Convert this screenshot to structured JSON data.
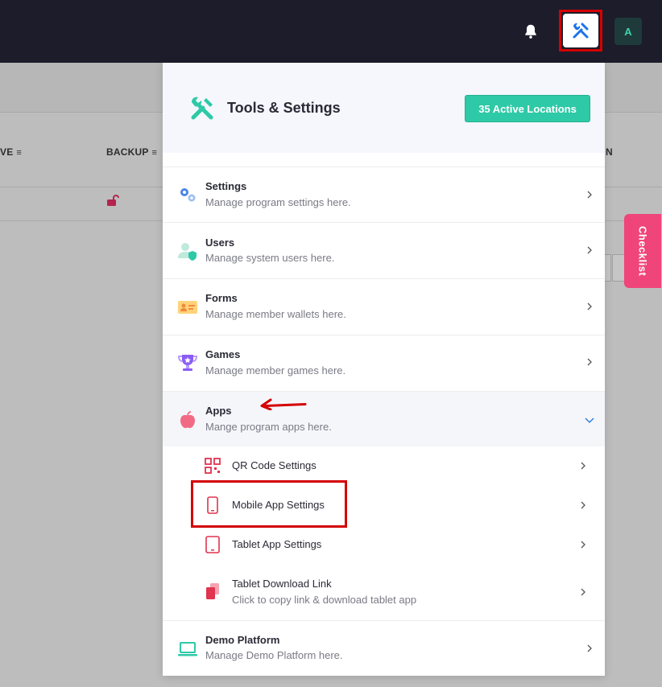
{
  "topbar": {
    "avatar_letter": "A",
    "icons": [
      "bell-icon",
      "tools-icon"
    ]
  },
  "background": {
    "columns": [
      "VE",
      "BACKUP",
      "N"
    ],
    "checklist_label": "Checklist"
  },
  "panel": {
    "title": "Tools & Settings",
    "badge": "35 Active Locations",
    "items": [
      {
        "title": "Settings",
        "desc": "Manage program settings here.",
        "icon": "gears-icon"
      },
      {
        "title": "Users",
        "desc": "Manage system users here.",
        "icon": "user-shield-icon"
      },
      {
        "title": "Forms",
        "desc": "Manage member wallets here.",
        "icon": "id-card-icon"
      },
      {
        "title": "Games",
        "desc": "Manage member games here.",
        "icon": "trophy-icon"
      },
      {
        "title": "Apps",
        "desc": "Mange program apps here.",
        "icon": "apple-icon"
      }
    ],
    "sub_items": [
      {
        "title": "QR Code Settings",
        "icon": "qr-code-icon"
      },
      {
        "title": "Mobile App Settings",
        "icon": "mobile-icon"
      },
      {
        "title": "Tablet App Settings",
        "icon": "tablet-icon"
      },
      {
        "title": "Tablet Download Link",
        "desc": "Click to copy link & download tablet app",
        "icon": "copy-icon"
      }
    ],
    "last_item": {
      "title": "Demo Platform",
      "desc": "Manage Demo Platform here.",
      "icon": "laptop-icon"
    }
  },
  "colors": {
    "accent": "#2ec9a6",
    "highlight": "#d40000",
    "checklist": "#f0457a",
    "topbar": "#1c1c2b"
  }
}
